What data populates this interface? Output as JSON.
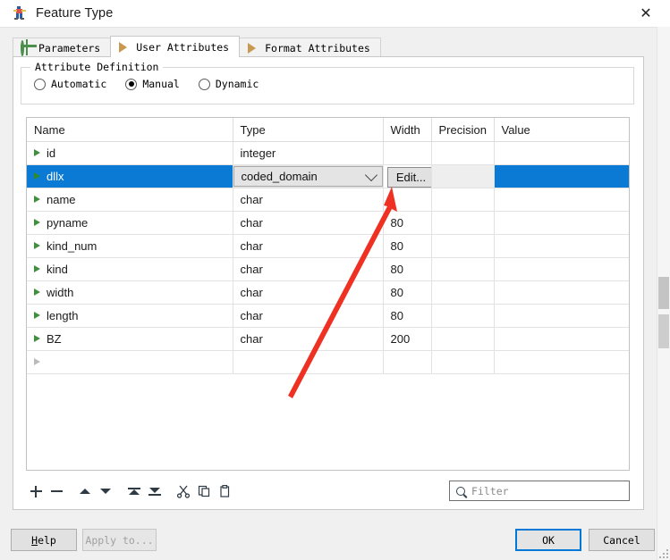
{
  "window": {
    "title": "Feature Type",
    "icon": "fme-feature-type-icon",
    "close_label": "✕"
  },
  "tabs": [
    {
      "label": "Parameters",
      "icon": "gear-icon",
      "active": false
    },
    {
      "label": "User Attributes",
      "icon": "orange-arrow-icon",
      "active": true
    },
    {
      "label": "Format Attributes",
      "icon": "orange-arrow-icon",
      "active": false
    }
  ],
  "attribute_definition": {
    "group_title": "Attribute Definition",
    "options": [
      {
        "label": "Automatic",
        "checked": false
      },
      {
        "label": "Manual",
        "checked": true
      },
      {
        "label": "Dynamic",
        "checked": false
      }
    ]
  },
  "table": {
    "columns": [
      "Name",
      "Type",
      "Width",
      "Precision",
      "Value"
    ],
    "rows": [
      {
        "name": "id",
        "type": "integer",
        "width": "",
        "precision": "",
        "value": "",
        "selected": false
      },
      {
        "name": "dllx",
        "type": "coded_domain",
        "width": "",
        "precision": "",
        "value": "",
        "selected": true,
        "edit_label": "Edit..."
      },
      {
        "name": "name",
        "type": "char",
        "width": "",
        "precision": "",
        "value": "",
        "selected": false
      },
      {
        "name": "pyname",
        "type": "char",
        "width": "80",
        "precision": "",
        "value": "",
        "selected": false
      },
      {
        "name": "kind_num",
        "type": "char",
        "width": "80",
        "precision": "",
        "value": "",
        "selected": false
      },
      {
        "name": "kind",
        "type": "char",
        "width": "80",
        "precision": "",
        "value": "",
        "selected": false
      },
      {
        "name": "width",
        "type": "char",
        "width": "80",
        "precision": "",
        "value": "",
        "selected": false
      },
      {
        "name": "length",
        "type": "char",
        "width": "80",
        "precision": "",
        "value": "",
        "selected": false
      },
      {
        "name": "BZ",
        "type": "char",
        "width": "200",
        "precision": "",
        "value": "",
        "selected": false
      },
      {
        "name": "",
        "type": "",
        "width": "",
        "precision": "",
        "value": "",
        "selected": false
      }
    ]
  },
  "toolbar": {
    "buttons": [
      {
        "name": "add",
        "icon": "plus-icon"
      },
      {
        "name": "remove",
        "icon": "minus-icon"
      },
      {
        "name": "move-up",
        "icon": "triangle-up-icon"
      },
      {
        "name": "move-down",
        "icon": "triangle-down-icon"
      },
      {
        "name": "move-to-top",
        "icon": "move-to-top-icon"
      },
      {
        "name": "move-to-bottom",
        "icon": "move-to-bottom-icon"
      },
      {
        "name": "cut",
        "icon": "scissors-icon"
      },
      {
        "name": "copy",
        "icon": "copy-icon"
      },
      {
        "name": "paste",
        "icon": "clipboard-icon"
      }
    ]
  },
  "filter": {
    "placeholder": "Filter",
    "value": "",
    "icon": "search-icon"
  },
  "footer": {
    "help": "Help",
    "apply_to": "Apply to...",
    "ok": "OK",
    "cancel": "Cancel"
  },
  "colors": {
    "selection": "#0a7ad4",
    "focus_ring": "#0078d7",
    "annotation_arrow": "#ef3124",
    "expander_green": "#3f8f3f",
    "tab_icon_orange": "#c89a4f"
  }
}
